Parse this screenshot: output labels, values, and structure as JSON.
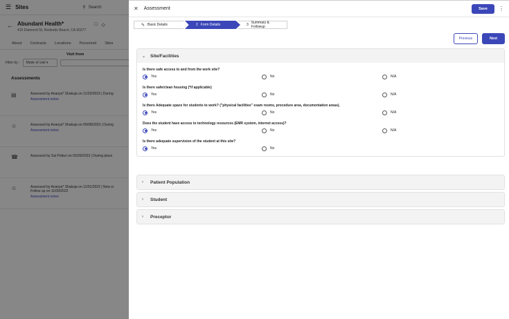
{
  "background": {
    "app_title": "Sites",
    "search_label": "Search",
    "site_name": "Abundant Health*",
    "site_address": "415 Diamond St, Redondo Beach, CA 90277",
    "nav_tabs": [
      "About",
      "Contracts",
      "Locations",
      "Personnel",
      "Sites"
    ],
    "visit_from_label": "Visit from",
    "filter_label": "Filter by :",
    "filter_select": "Mode of visit",
    "assessments_title": "Assessments",
    "items": [
      {
        "icon": "video-icon",
        "text": "Assessed by Ananya* Shakuja on 11/23/2023  |  During",
        "link": "Assessment notes"
      },
      {
        "icon": "person-icon",
        "text": "Assessed by Ananya* Shakuja on 05/08/2023  |  During",
        "link": "Assessment notes"
      },
      {
        "icon": "phone-icon",
        "text": "Assessed by Sai Potturi on 03/29/2023  |  During place",
        "link": ""
      },
      {
        "icon": "person-icon",
        "text": "Assessed by Ananya* Shakuja on 11/01/2022  |  New si",
        "followup": "Follow up on 11/09/2022",
        "link": "Assessment notes"
      }
    ]
  },
  "panel": {
    "title": "Assessment",
    "save_label": "Save",
    "steps": [
      {
        "num": "",
        "label": "Basic Details"
      },
      {
        "num": "2",
        "label": "Form Details"
      },
      {
        "num": "3",
        "label": "Summary & Followup"
      }
    ],
    "previous_label": "Previous",
    "next_label": "Next",
    "sections": [
      {
        "title": "Site/Facilities",
        "expanded": true
      },
      {
        "title": "Patient Population",
        "expanded": false
      },
      {
        "title": "Student",
        "expanded": false
      },
      {
        "title": "Preceptor",
        "expanded": false
      }
    ],
    "questions": [
      {
        "text": "Is there safe access to and from the work site?",
        "options": [
          "Yes",
          "No",
          "N/A"
        ],
        "selected": "Yes"
      },
      {
        "text": "Is there safe/clean housing (*if applicable)",
        "options": [
          "Yes",
          "No",
          "N/A"
        ],
        "selected": "Yes"
      },
      {
        "text": "Is there Adequate space for students to work? (\"physical facilities\" exam rooms, procedure area, documentation areas).",
        "options": [
          "Yes",
          "No",
          "N/A"
        ],
        "selected": "Yes"
      },
      {
        "text": "Does the student have access to technology resources (EMR system, internet access)?",
        "options": [
          "Yes",
          "No",
          "N/A"
        ],
        "selected": "Yes"
      },
      {
        "text": "Is there adequate supervision of the student at this site?",
        "options": [
          "Yes",
          "No"
        ],
        "selected": "Yes"
      }
    ]
  },
  "colors": {
    "accent": "#3b47b8",
    "overlay": "rgba(0,0,0,0.47)"
  }
}
